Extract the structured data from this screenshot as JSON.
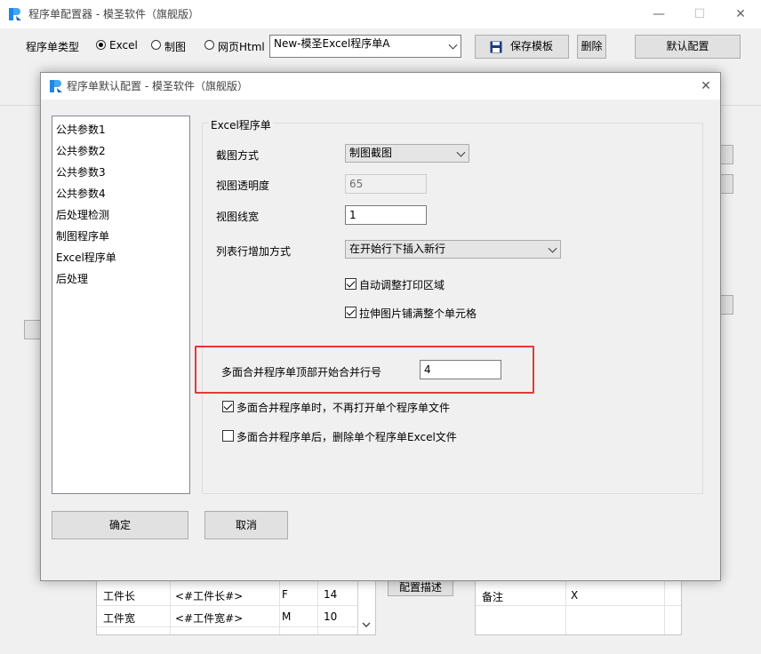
{
  "app": {
    "title": "程序单配置器 - 模圣软件（旗舰版）",
    "controls": {
      "minimize": "—",
      "maximize": "☐",
      "close": "✕"
    }
  },
  "toolbar": {
    "type_label": "程序单类型",
    "radios": [
      {
        "label": "Excel",
        "checked": true
      },
      {
        "label": "制图",
        "checked": false
      },
      {
        "label": "网页Html",
        "checked": false
      }
    ],
    "template_select": "New-模圣Excel程序单A",
    "save_button": "保存模板",
    "delete_button": "删除",
    "default_button": "默认配置"
  },
  "background": {
    "config_desc_button": "配置描述",
    "left_table": {
      "rows": [
        [
          "工件长",
          "<#工件长#>",
          "F",
          "14"
        ],
        [
          "工件宽",
          "<#工件宽#>",
          "M",
          "10"
        ]
      ]
    },
    "right_table": {
      "rows": [
        [
          "备注",
          "X"
        ]
      ]
    }
  },
  "dialog": {
    "title": "程序单默认配置 - 模圣软件（旗舰版）",
    "close": "✕",
    "nav": [
      "公共参数1",
      "公共参数2",
      "公共参数3",
      "公共参数4",
      "后处理检测",
      "制图程序单",
      "Excel程序单",
      "后处理"
    ],
    "group_title": "Excel程序单",
    "fields": {
      "screenshot_mode": {
        "label": "截图方式",
        "value": "制图截图"
      },
      "view_opacity": {
        "label": "视图透明度",
        "value": "65"
      },
      "view_linewidth": {
        "label": "视图线宽",
        "value": "1"
      },
      "row_add_mode": {
        "label": "列表行增加方式",
        "value": "在开始行下插入新行"
      }
    },
    "checkboxes": {
      "auto_print_area": {
        "label": "自动调整打印区域",
        "checked": true
      },
      "stretch_image": {
        "label": "拉伸图片铺满整个单元格",
        "checked": true
      },
      "no_open_single": {
        "label": "多面合并程序单时，不再打开单个程序单文件",
        "checked": true
      },
      "delete_single": {
        "label": "多面合并程序单后，删除单个程序单Excel文件",
        "checked": false
      }
    },
    "merge_start_row": {
      "label": "多面合并程序单顶部开始合并行号",
      "value": "4"
    },
    "ok_button": "确定",
    "cancel_button": "取消"
  },
  "colors": {
    "highlight": "#e53935",
    "logo": "#1e88e5"
  }
}
